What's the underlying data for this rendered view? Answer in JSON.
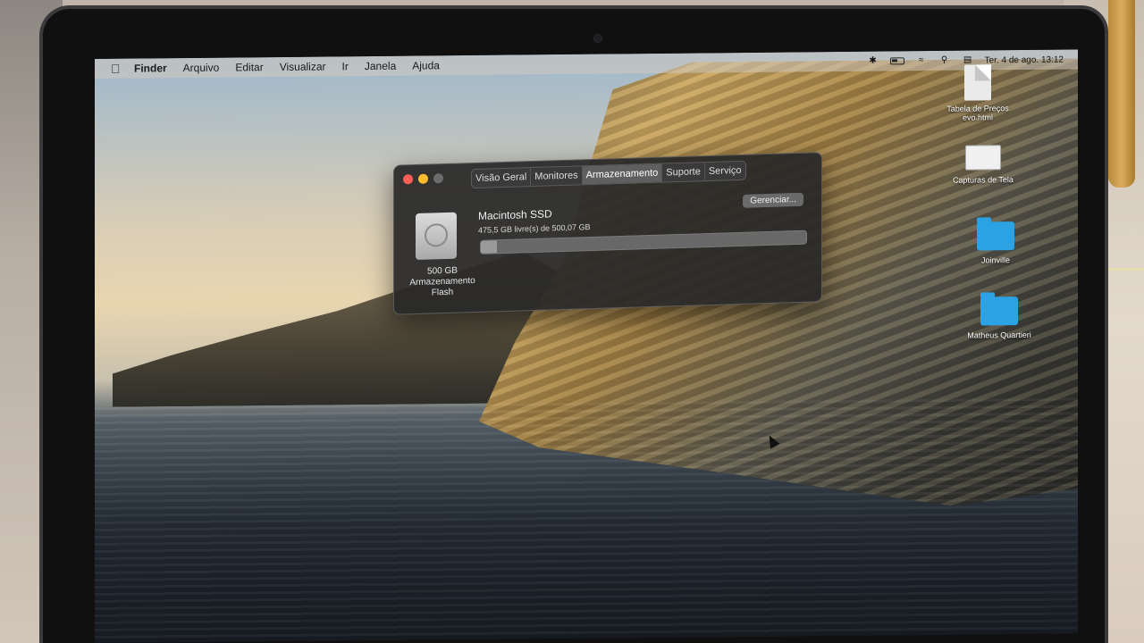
{
  "menubar": {
    "app_name": "Finder",
    "items": [
      "Arquivo",
      "Editar",
      "Visualizar",
      "Ir",
      "Janela",
      "Ajuda"
    ],
    "clock": "Ter. 4 de ago.  13:12"
  },
  "desktop_icons": [
    {
      "label": "Tabela de Preços evo.html",
      "icon": "html-file-icon"
    },
    {
      "label": "Capturas de Tela",
      "icon": "screenshot-icon"
    },
    {
      "label": "Joinville",
      "icon": "folder-icon"
    },
    {
      "label": "Matheus Quartieri",
      "icon": "folder-icon"
    }
  ],
  "window": {
    "tabs": [
      "Visão Geral",
      "Monitores",
      "Armazenamento",
      "Suporte",
      "Serviço"
    ],
    "active_tab": "Armazenamento",
    "disk_caption_lines": [
      "500 GB",
      "Armazenamento",
      "Flash"
    ],
    "disk_name": "Macintosh SSD",
    "disk_free": "475,5 GB livre(s) de 500,07 GB",
    "manage_label": "Gerenciar...",
    "used_fraction": 0.049
  },
  "colors": {
    "folder": "#2aa2e4",
    "window_bg": "#282828",
    "red": "#fd5f57",
    "yellow": "#febc2e"
  }
}
